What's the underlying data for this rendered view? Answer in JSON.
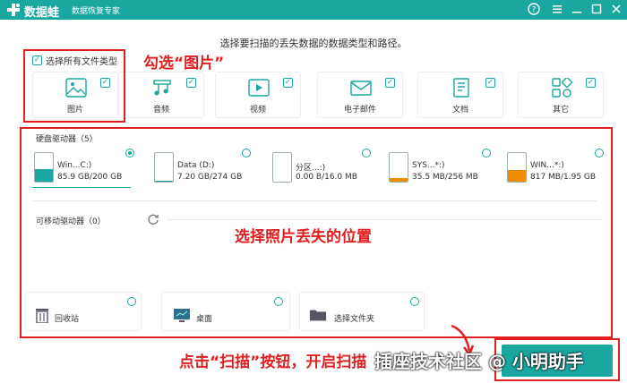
{
  "app": {
    "brand": "数据蛙",
    "subtitle": "数据恢复专家",
    "title_icons": [
      "help-icon",
      "menu-icon",
      "minimize-icon",
      "maximize-icon",
      "close-icon"
    ]
  },
  "instruction": "选择要扫描的丢失数据的数据类型和路径。",
  "select_all": {
    "label": "选择所有文件类型",
    "checked": true
  },
  "file_types": [
    {
      "label": "图片",
      "icon": "image-icon",
      "checked": true
    },
    {
      "label": "音频",
      "icon": "music-icon",
      "checked": true
    },
    {
      "label": "视频",
      "icon": "video-icon",
      "checked": true
    },
    {
      "label": "电子邮件",
      "icon": "email-icon",
      "checked": true
    },
    {
      "label": "文档",
      "icon": "document-icon",
      "checked": true
    },
    {
      "label": "其它",
      "icon": "other-icon",
      "checked": true
    }
  ],
  "hard_drives": {
    "title": "硬盘驱动器（5）",
    "items": [
      {
        "name": "Win...C:)",
        "size": "85.9 GB/200 GB",
        "used_fraction": 0.43,
        "color": "#1aa7a0",
        "selected": true
      },
      {
        "name": "Data (D:)",
        "size": "7.20 GB/274 GB",
        "used_fraction": 0.03,
        "color": "#1aa7a0",
        "selected": false
      },
      {
        "name": "分区...:)",
        "size": "0.00  B/16.0 MB",
        "used_fraction": 0.0,
        "color": "#f08c00",
        "selected": false
      },
      {
        "name": "SYS...*:)",
        "size": "35.5 MB/256 MB",
        "used_fraction": 0.14,
        "color": "#f08c00",
        "selected": false
      },
      {
        "name": "WIN...*:)",
        "size": "817 MB/1.95 GB",
        "used_fraction": 0.42,
        "color": "#f08c00",
        "selected": false
      }
    ]
  },
  "removable": {
    "title": "可移动驱动器（0）",
    "refresh_icon": "refresh-icon"
  },
  "locations": [
    {
      "label": "回收站",
      "icon": "recycle-bin-icon"
    },
    {
      "label": "桌面",
      "icon": "desktop-icon"
    },
    {
      "label": "选择文件夹",
      "icon": "folder-icon"
    }
  ],
  "annotations": {
    "check_image": "勾选“图片”",
    "select_location": "选择照片丢失的位置",
    "click_scan": "点击“扫描”按钮，开启扫描"
  },
  "watermark": "插座技术社区 @ 小明助手",
  "colors": {
    "accent": "#1aa7a0",
    "annotation": "#e02020",
    "orange": "#f08c00"
  }
}
